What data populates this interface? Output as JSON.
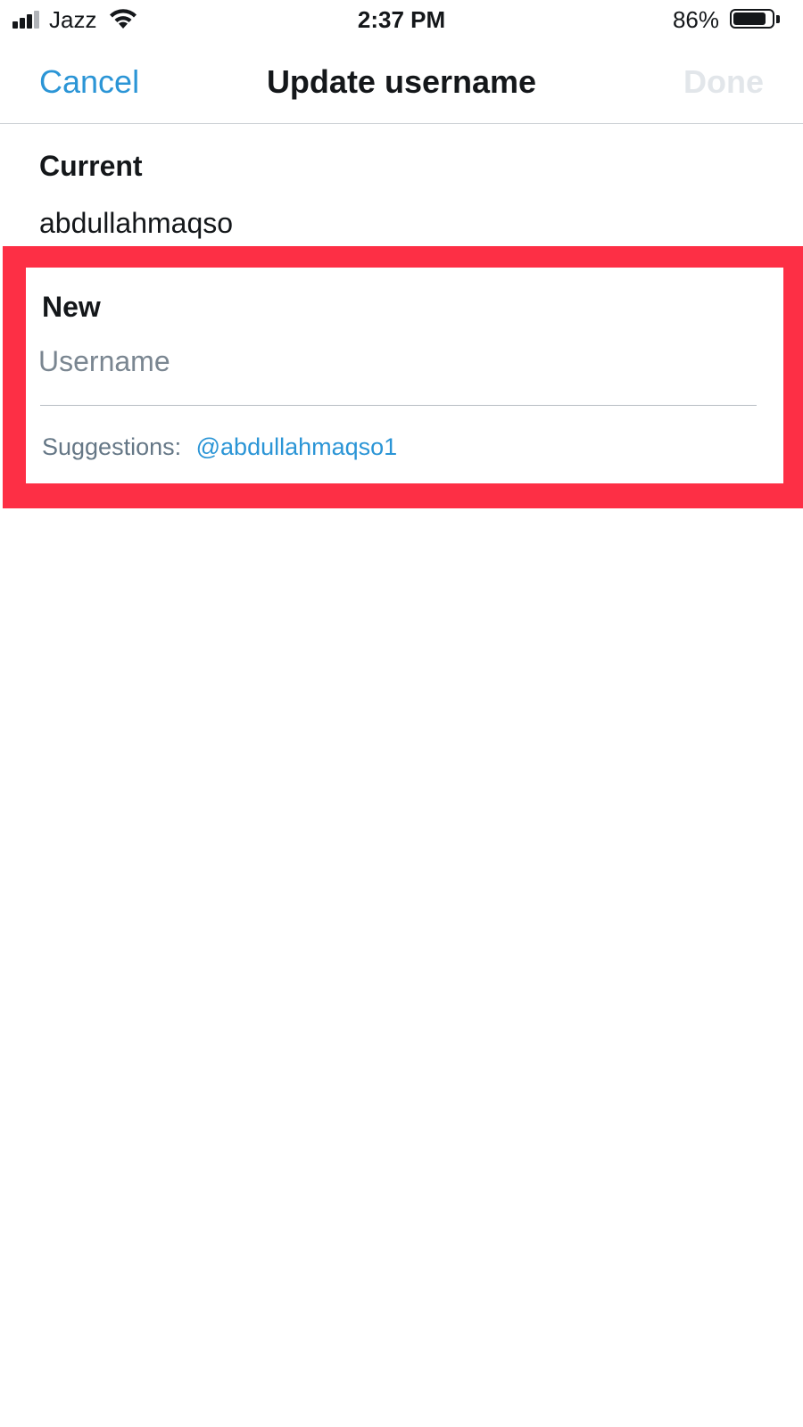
{
  "status_bar": {
    "carrier": "Jazz",
    "time": "2:37 PM",
    "battery_percent": "86%",
    "battery_level": 0.86,
    "signal_bars_total": 4,
    "signal_bars_active": 3
  },
  "nav": {
    "cancel_label": "Cancel",
    "title": "Update username",
    "done_label": "Done"
  },
  "current": {
    "label": "Current",
    "value": "abdullahmaqso"
  },
  "new_username": {
    "label": "New",
    "placeholder": "Username",
    "value": "",
    "suggestions_prefix": "Suggestions:",
    "suggestion": "@abdullahmaqso1"
  },
  "colors": {
    "accent": "#2b95d6",
    "highlight": "#fd2f45",
    "done_disabled": "#e2e6ea",
    "secondary_text": "#657786"
  }
}
